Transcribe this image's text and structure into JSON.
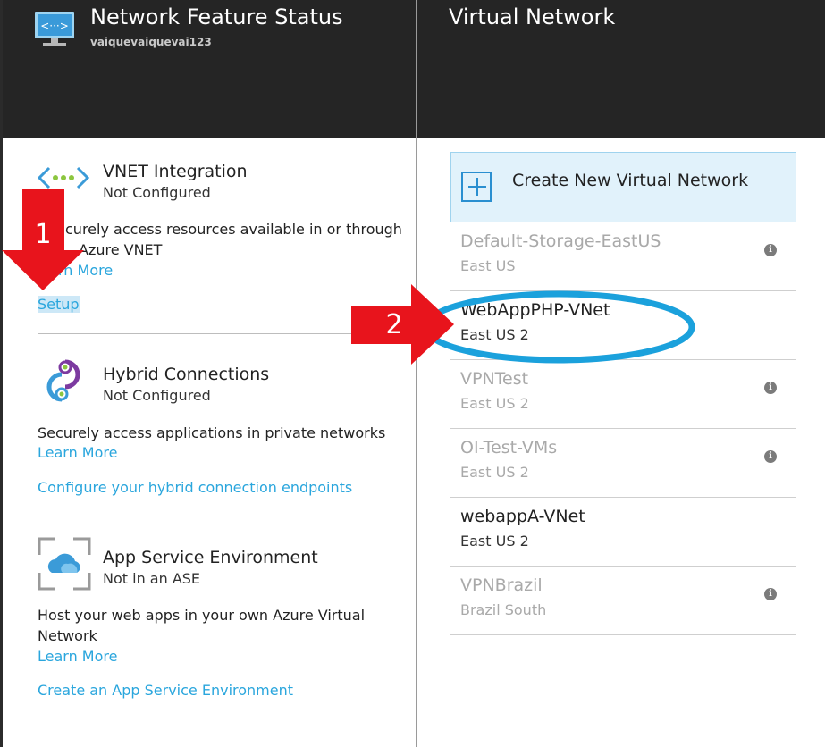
{
  "left_blade": {
    "title": "Network Feature Status",
    "subtitle": "vaiquevaiquevai123",
    "vnet": {
      "title": "VNET Integration",
      "status": "Not Configured",
      "desc_line1": "curely access resources available in or through",
      "desc_line2": "Azure VNET",
      "learn_more": "rn More",
      "setup": "Setup"
    },
    "hybrid": {
      "title": "Hybrid Connections",
      "status": "Not Configured",
      "desc": "Securely access applications in private networks",
      "learn_more": "Learn More",
      "configure": "Configure your hybrid connection endpoints"
    },
    "ase": {
      "title": "App Service Environment",
      "status": "Not in an ASE",
      "desc_line1": "Host your web apps in your own Azure Virtual",
      "desc_line2": "Network",
      "learn_more": "Learn More",
      "create": "Create an App Service Environment"
    }
  },
  "right_blade": {
    "title": "Virtual Network",
    "create_label": "Create New Virtual Network",
    "networks": [
      {
        "name": "Default-Storage-EastUS",
        "location": "East US"
      },
      {
        "name": "WebAppPHP-VNet",
        "location": "East US 2"
      },
      {
        "name": "VPNTest",
        "location": "East US 2"
      },
      {
        "name": "OI-Test-VMs",
        "location": "East US 2"
      },
      {
        "name": "webappA-VNet",
        "location": "East US 2"
      },
      {
        "name": "VPNBrazil",
        "location": "Brazil South"
      }
    ],
    "info_symbol": "i"
  },
  "annotations": {
    "step1": "1",
    "step2": "2",
    "arrow_color": "#e8141c",
    "ellipse_color": "#1ba1dc"
  }
}
